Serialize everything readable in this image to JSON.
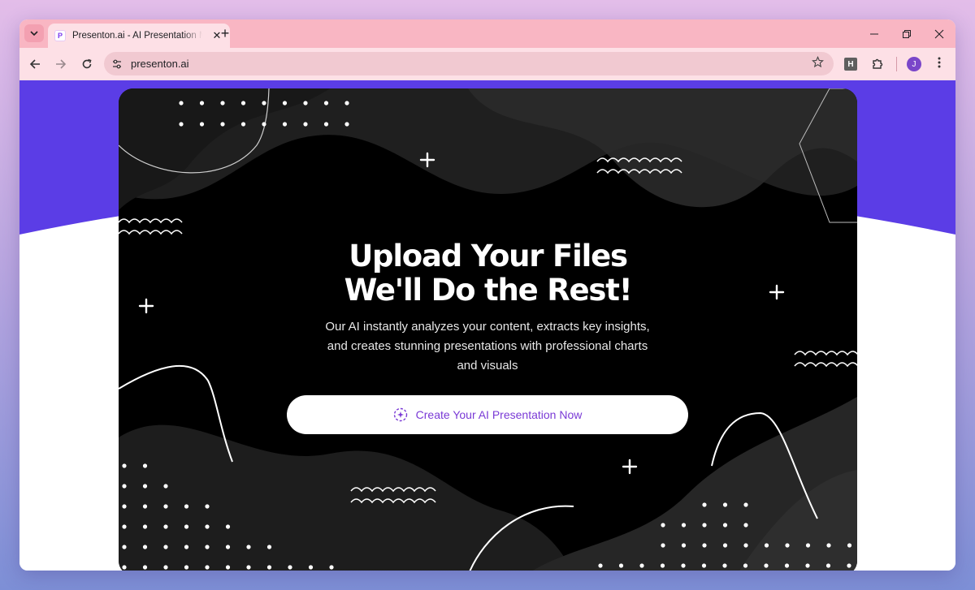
{
  "browser": {
    "tab": {
      "title": "Presenton.ai - AI Presentation Maker",
      "favicon_letter": "P"
    },
    "url": "presenton.ai",
    "extension_label": "H",
    "profile_initial": "J",
    "new_tab_symbol": "+",
    "close_symbol": "✕"
  },
  "hero": {
    "title_line1": "Upload Your Files",
    "title_line2": "We'll Do the Rest!",
    "subtitle": "Our AI instantly analyzes your content, extracts key insights, and creates stunning presentations with professional charts and visuals",
    "cta_label": "Create Your AI Presentation Now"
  },
  "colors": {
    "tabstrip": "#f9b6c3",
    "toolbar": "#fde0e6",
    "band_purple": "#5b3de6",
    "hero_bg": "#000000",
    "cta_text": "#7a3ad6"
  }
}
